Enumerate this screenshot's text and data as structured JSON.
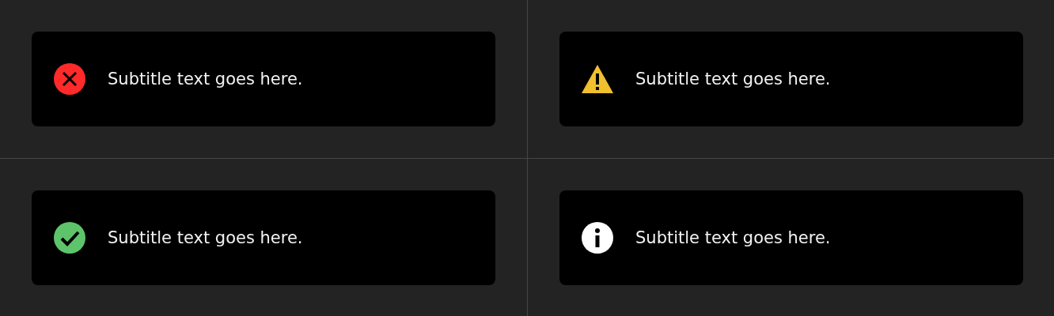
{
  "toasts": [
    {
      "kind": "error",
      "text": "Subtitle text goes here."
    },
    {
      "kind": "warning",
      "text": "Subtitle text goes here."
    },
    {
      "kind": "success",
      "text": "Subtitle text goes here."
    },
    {
      "kind": "info",
      "text": "Subtitle text goes here."
    }
  ]
}
